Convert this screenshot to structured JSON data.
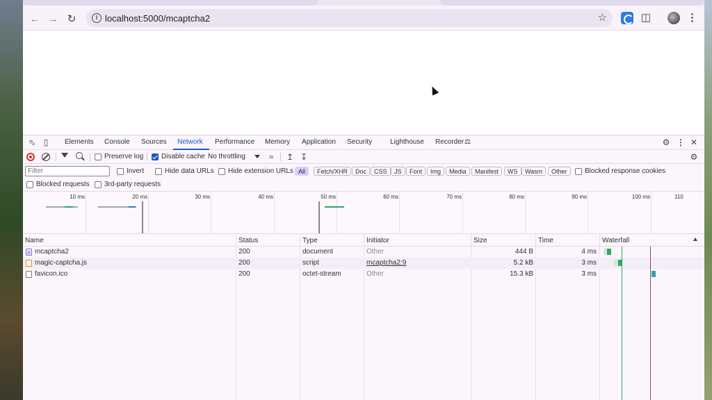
{
  "browser": {
    "url": "localhost:5000/mcaptcha2"
  },
  "devtools": {
    "tabs": [
      "Elements",
      "Console",
      "Sources",
      "Network",
      "Performance",
      "Memory",
      "Application",
      "Security",
      "Lighthouse",
      "Recorder"
    ],
    "active_tab": "Network",
    "toolbar": {
      "preserve_log": "Preserve log",
      "preserve_log_checked": false,
      "disable_cache": "Disable cache",
      "disable_cache_checked": true,
      "throttling": "No throttling"
    },
    "filter_bar": {
      "filter_placeholder": "Filter",
      "invert": "Invert",
      "hide_data_urls": "Hide data URLs",
      "hide_extension_urls": "Hide extension URLs",
      "chips": [
        "All",
        "Fetch/XHR",
        "Doc",
        "CSS",
        "JS",
        "Font",
        "Img",
        "Media",
        "Manifest",
        "WS",
        "Wasm",
        "Other"
      ],
      "active_chip": "All",
      "blocked_response_cookies": "Blocked response cookies",
      "blocked_requests": "Blocked requests",
      "third_party_requests": "3rd-party requests"
    },
    "overview_ticks": [
      "10 ms",
      "20 ms",
      "30 ms",
      "40 ms",
      "50 ms",
      "60 ms",
      "70 ms",
      "80 ms",
      "90 ms",
      "100 ms",
      "110"
    ],
    "table": {
      "columns": [
        "Name",
        "Status",
        "Type",
        "Initiator",
        "Size",
        "Time",
        "Waterfall"
      ],
      "rows": [
        {
          "name": "mcaptcha2",
          "status": "200",
          "type": "document",
          "initiator": "Other",
          "size": "444 B",
          "time": "4 ms"
        },
        {
          "name": "magic-captcha.js",
          "status": "200",
          "type": "script",
          "initiator": "mcaptcha2:9",
          "size": "5.2 kB",
          "time": "3 ms"
        },
        {
          "name": "favicon.ico",
          "status": "200",
          "type": "octet-stream",
          "initiator": "Other",
          "size": "15.3 kB",
          "time": "3 ms"
        }
      ]
    }
  },
  "colors": {
    "accent": "#1a57c0",
    "record": "#d93025",
    "waterfall_green": "#2fa866",
    "waterfall_teal": "#3a9fb0"
  }
}
